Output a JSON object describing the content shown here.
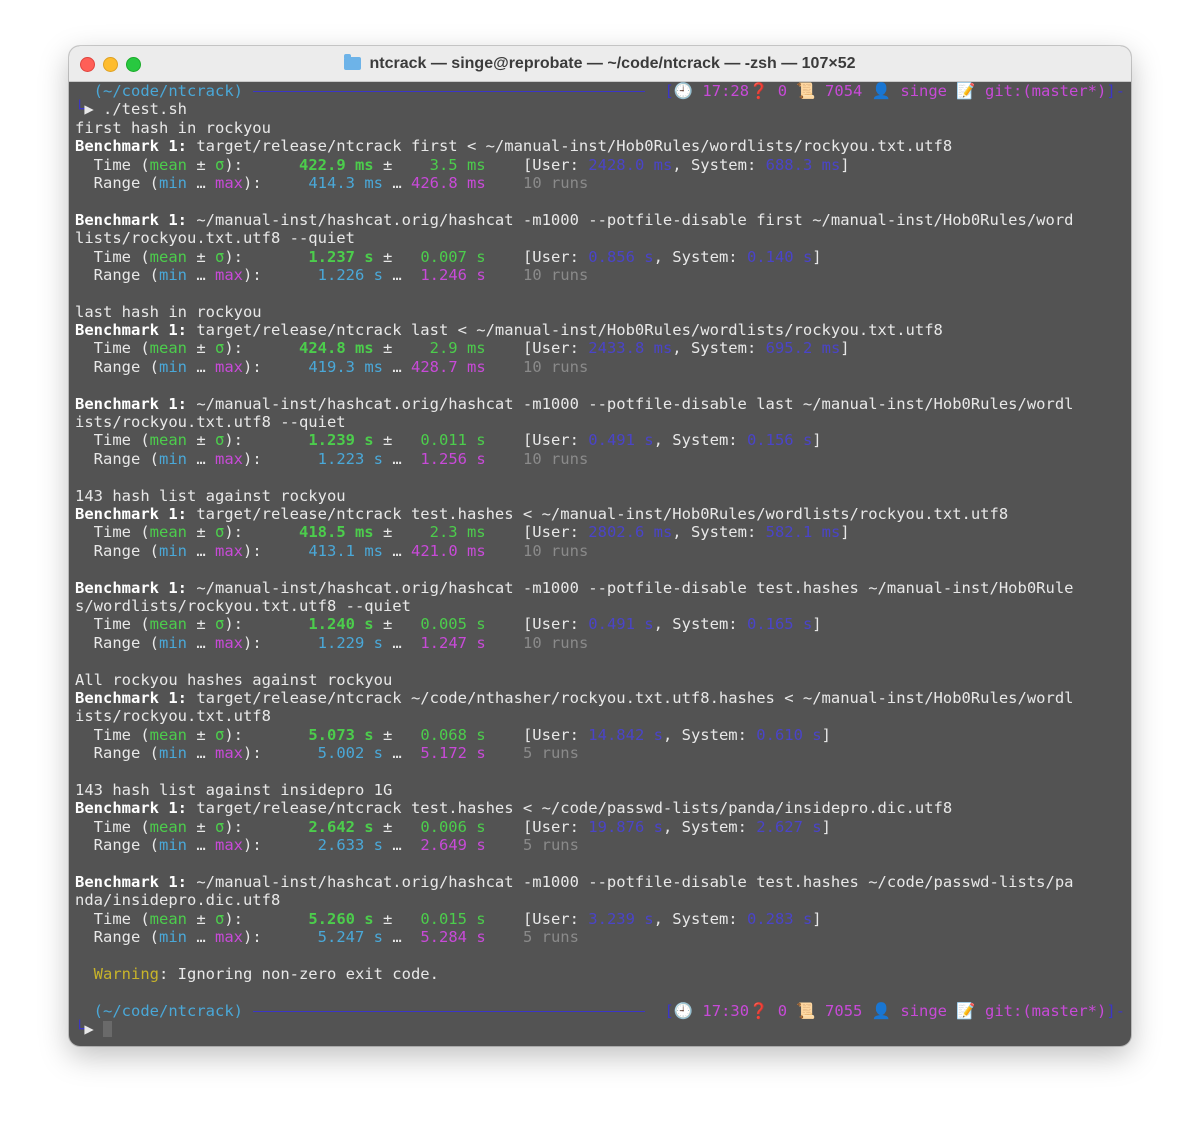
{
  "window": {
    "title": "ntcrack — singe@reprobate — ~/code/ntcrack — -zsh — 107×52"
  },
  "colors": {
    "bg": "#535353",
    "green": "#4ccd4c",
    "cyan": "#4aa8d8",
    "magenta": "#c84ad8",
    "blue": "#4a44c8",
    "yellow": "#c8b42a"
  },
  "prompt1": {
    "path": "(~/code/ntcrack)",
    "time": "17:28",
    "exit": "0",
    "hist": "7054",
    "user": "singe",
    "git": "git:(master*)",
    "command": "./test.sh"
  },
  "prompt2": {
    "path": "(~/code/ntcrack)",
    "time": "17:30",
    "exit": "0",
    "hist": "7055",
    "user": "singe",
    "git": "git:(master*)"
  },
  "labels": {
    "benchmark": "Benchmark 1:",
    "time": "Time",
    "mean": "mean",
    "pm": "±",
    "sigma": "σ",
    "range": "Range",
    "min": "min",
    "ellipsis": "…",
    "max": "max",
    "user": "[User:",
    "system": "System:",
    "warning": "Warning",
    "warning_text": ": Ignoring non-zero exit code."
  },
  "sections": [
    {
      "heading": "first hash in rockyou",
      "benchmarks": [
        {
          "cmd": [
            "target/release/ntcrack first < ~/manual-inst/Hob0Rules/wordlists/rockyou.txt.utf8"
          ],
          "mean": "422.9 ms",
          "sd": "3.5 ms",
          "user": "2428.0 ms",
          "system": "688.3 ms",
          "min": "414.3 ms",
          "max": "426.8 ms",
          "runs": "10 runs"
        },
        {
          "cmd": [
            "~/manual-inst/hashcat.orig/hashcat -m1000 --potfile-disable first ~/manual-inst/Hob0Rules/word",
            "lists/rockyou.txt.utf8 --quiet"
          ],
          "mean": "1.237 s",
          "sd": "0.007 s",
          "user": "0.856 s",
          "system": "0.140 s",
          "min": "1.226 s",
          "max": "1.246 s",
          "runs": "10 runs"
        }
      ]
    },
    {
      "heading": "last hash in rockyou",
      "benchmarks": [
        {
          "cmd": [
            "target/release/ntcrack last < ~/manual-inst/Hob0Rules/wordlists/rockyou.txt.utf8"
          ],
          "mean": "424.8 ms",
          "sd": "2.9 ms",
          "user": "2433.8 ms",
          "system": "695.2 ms",
          "min": "419.3 ms",
          "max": "428.7 ms",
          "runs": "10 runs"
        },
        {
          "cmd": [
            "~/manual-inst/hashcat.orig/hashcat -m1000 --potfile-disable last ~/manual-inst/Hob0Rules/wordl",
            "ists/rockyou.txt.utf8 --quiet"
          ],
          "mean": "1.239 s",
          "sd": "0.011 s",
          "user": "0.491 s",
          "system": "0.156 s",
          "min": "1.223 s",
          "max": "1.256 s",
          "runs": "10 runs"
        }
      ]
    },
    {
      "heading": "143 hash list against rockyou",
      "benchmarks": [
        {
          "cmd": [
            "target/release/ntcrack test.hashes < ~/manual-inst/Hob0Rules/wordlists/rockyou.txt.utf8"
          ],
          "mean": "418.5 ms",
          "sd": "2.3 ms",
          "user": "2802.6 ms",
          "system": "582.1 ms",
          "min": "413.1 ms",
          "max": "421.0 ms",
          "runs": "10 runs"
        },
        {
          "cmd": [
            "~/manual-inst/hashcat.orig/hashcat -m1000 --potfile-disable test.hashes ~/manual-inst/Hob0Rule",
            "s/wordlists/rockyou.txt.utf8 --quiet"
          ],
          "mean": "1.240 s",
          "sd": "0.005 s",
          "user": "0.491 s",
          "system": "0.165 s",
          "min": "1.229 s",
          "max": "1.247 s",
          "runs": "10 runs"
        }
      ]
    },
    {
      "heading": "All rockyou hashes against rockyou",
      "benchmarks": [
        {
          "cmd": [
            "target/release/ntcrack ~/code/nthasher/rockyou.txt.utf8.hashes < ~/manual-inst/Hob0Rules/wordl",
            "ists/rockyou.txt.utf8"
          ],
          "mean": "5.073 s",
          "sd": "0.068 s",
          "user": "14.842 s",
          "system": "0.610 s",
          "min": "5.002 s",
          "max": "5.172 s",
          "runs": "5 runs"
        }
      ]
    },
    {
      "heading": "143 hash list against insidepro 1G",
      "benchmarks": [
        {
          "cmd": [
            "target/release/ntcrack test.hashes < ~/code/passwd-lists/panda/insidepro.dic.utf8"
          ],
          "mean": "2.642 s",
          "sd": "0.006 s",
          "user": "19.876 s",
          "system": "2.627 s",
          "min": "2.633 s",
          "max": "2.649 s",
          "runs": "5 runs"
        },
        {
          "cmd": [
            "~/manual-inst/hashcat.orig/hashcat -m1000 --potfile-disable test.hashes ~/code/passwd-lists/pa",
            "nda/insidepro.dic.utf8"
          ],
          "mean": "5.260 s",
          "sd": "0.015 s",
          "user": "3.239 s",
          "system": "0.283 s",
          "min": "5.247 s",
          "max": "5.284 s",
          "runs": "5 runs"
        }
      ]
    }
  ]
}
